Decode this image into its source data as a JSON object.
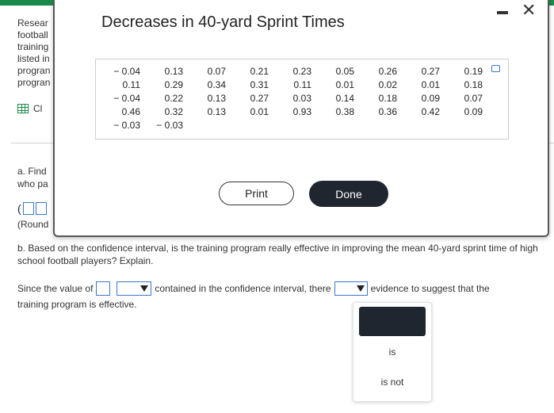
{
  "background": {
    "side_text": [
      "Resear",
      "football",
      "training",
      "listed in",
      "progran",
      "progran"
    ],
    "calculator_label": "Cl",
    "part_a_lines": [
      "a. Find",
      "who pa"
    ],
    "answer_prefix": "(",
    "round_text": "(Round",
    "part_b": "b. Based on the confidence interval, is the training program really effective in improving the mean 40-yard sprint time of high school football players? Explain.",
    "since_prefix": "Since the value of",
    "since_middle": "contained in the confidence interval, there",
    "since_suffix": "evidence to suggest that the",
    "since_line2": "training program is effective."
  },
  "dropdown": {
    "options": [
      "is",
      "is not"
    ]
  },
  "modal": {
    "title": "Decreases in 40-yard Sprint Times",
    "minimize_icon": "minimize-icon",
    "close_icon": "close-icon",
    "close_glyph": "✕",
    "table_rows": [
      [
        "− 0.04",
        "0.13",
        "0.07",
        "0.21",
        "0.23",
        "0.05",
        "0.26",
        "0.27",
        "0.19"
      ],
      [
        "0.11",
        "0.29",
        "0.34",
        "0.31",
        "0.11",
        "0.01",
        "0.02",
        "0.01",
        "0.18"
      ],
      [
        "− 0.04",
        "0.22",
        "0.13",
        "0.27",
        "0.03",
        "0.14",
        "0.18",
        "0.09",
        "0.07"
      ],
      [
        "0.46",
        "0.32",
        "0.13",
        "0.01",
        "0.93",
        "0.38",
        "0.36",
        "0.42",
        "0.09"
      ],
      [
        "− 0.03",
        "− 0.03",
        "",
        "",
        "",
        "",
        "",
        "",
        ""
      ]
    ],
    "print_label": "Print",
    "done_label": "Done"
  },
  "colors": {
    "accent_green": "#1a8a4a",
    "input_blue": "#3a78c9",
    "dark_button": "#1f2630"
  }
}
